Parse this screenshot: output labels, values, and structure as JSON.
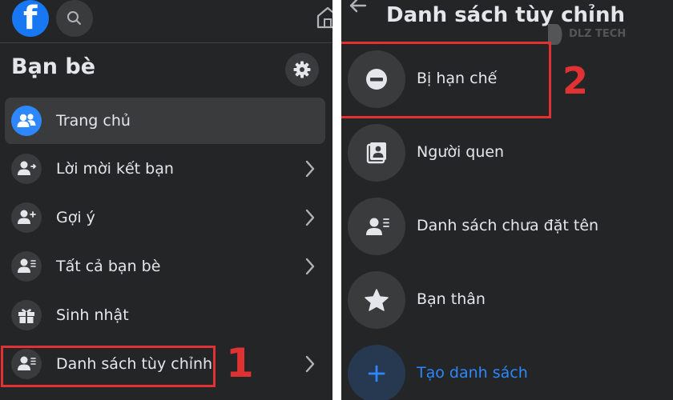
{
  "left": {
    "header": {
      "logo_icon": "facebook-logo",
      "search_icon": "search-icon",
      "home_icon": "home-icon"
    },
    "title": "Bạn bè",
    "settings_icon": "gear-icon",
    "items": [
      {
        "label": "Trang chủ",
        "icon": "friends-icon",
        "active": true,
        "chevron": false
      },
      {
        "label": "Lời mời kết bạn",
        "icon": "person-arrow-icon",
        "active": false,
        "chevron": true
      },
      {
        "label": "Gợi ý",
        "icon": "person-plus-icon",
        "active": false,
        "chevron": true
      },
      {
        "label": "Tất cả bạn bè",
        "icon": "person-list-icon",
        "active": false,
        "chevron": true
      },
      {
        "label": "Sinh nhật",
        "icon": "gift-icon",
        "active": false,
        "chevron": false
      },
      {
        "label": "Danh sách tùy chỉnh",
        "icon": "person-list-icon",
        "active": false,
        "chevron": true
      }
    ],
    "step_number": "1"
  },
  "right": {
    "title": "Danh sách tùy chỉnh",
    "back_icon": "back-arrow-icon",
    "watermark": "DLZ TECH",
    "items": [
      {
        "label": "Bị hạn chế",
        "icon": "restricted-icon"
      },
      {
        "label": "Người quen",
        "icon": "contact-card-icon"
      },
      {
        "label": "Danh sách chưa đặt tên",
        "icon": "person-list-icon"
      },
      {
        "label": "Bạn thân",
        "icon": "star-icon"
      },
      {
        "label": "Tạo danh sách",
        "icon": "plus-icon",
        "accent": true
      }
    ],
    "step_number": "2"
  },
  "colors": {
    "background": "#242526",
    "accent": "#2d88ff",
    "highlight": "#e03232",
    "text": "#e4e6eb"
  }
}
